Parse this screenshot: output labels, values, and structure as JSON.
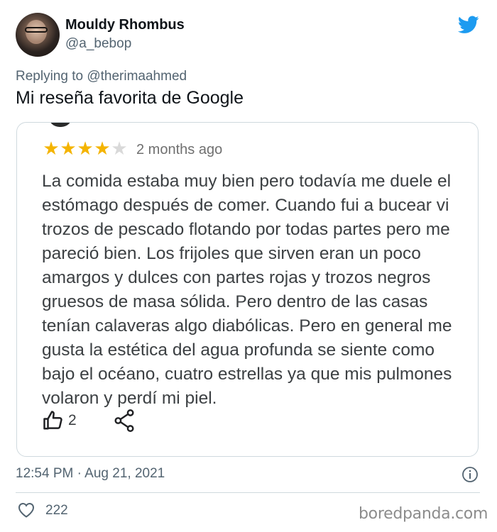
{
  "author": {
    "display_name": "Mouldy Rhombus",
    "handle": "@a_bebop",
    "avatar_icon": "user-avatar"
  },
  "platform_icon": "twitter-bird-icon",
  "colors": {
    "twitter_blue": "#1d9bf0",
    "star_gold": "#f4b400",
    "muted_text": "#536471"
  },
  "reply": {
    "prefix": "Replying to",
    "mention": "@therimaahmed"
  },
  "tweet_text": "Mi reseña favorita de Google",
  "review": {
    "rating": 4,
    "max_rating": 5,
    "date": "2 months ago",
    "body": "La comida estaba muy bien pero todavía me duele el estómago después de comer. Cuando fui a bucear vi trozos de pescado flotando por todas partes pero me pareció bien. Los frijoles que sirven eran un poco amargos y dulces con partes rojas y trozos negros gruesos de masa sólida. Pero dentro de las casas tenían calaveras algo diabólicas. Pero en general me gusta la estética del agua profunda se siente como bajo el océano, cuatro estrellas ya que mis pulmones volaron y perdí mi piel.",
    "helpful_count": "2",
    "like_icon": "thumbs-up-icon",
    "share_icon": "share-icon"
  },
  "meta": {
    "timestamp": "12:54 PM · Aug 21, 2021",
    "info_icon": "info-icon"
  },
  "engagement": {
    "likes": "222",
    "like_icon": "heart-icon"
  },
  "watermark": "boredpanda.com"
}
